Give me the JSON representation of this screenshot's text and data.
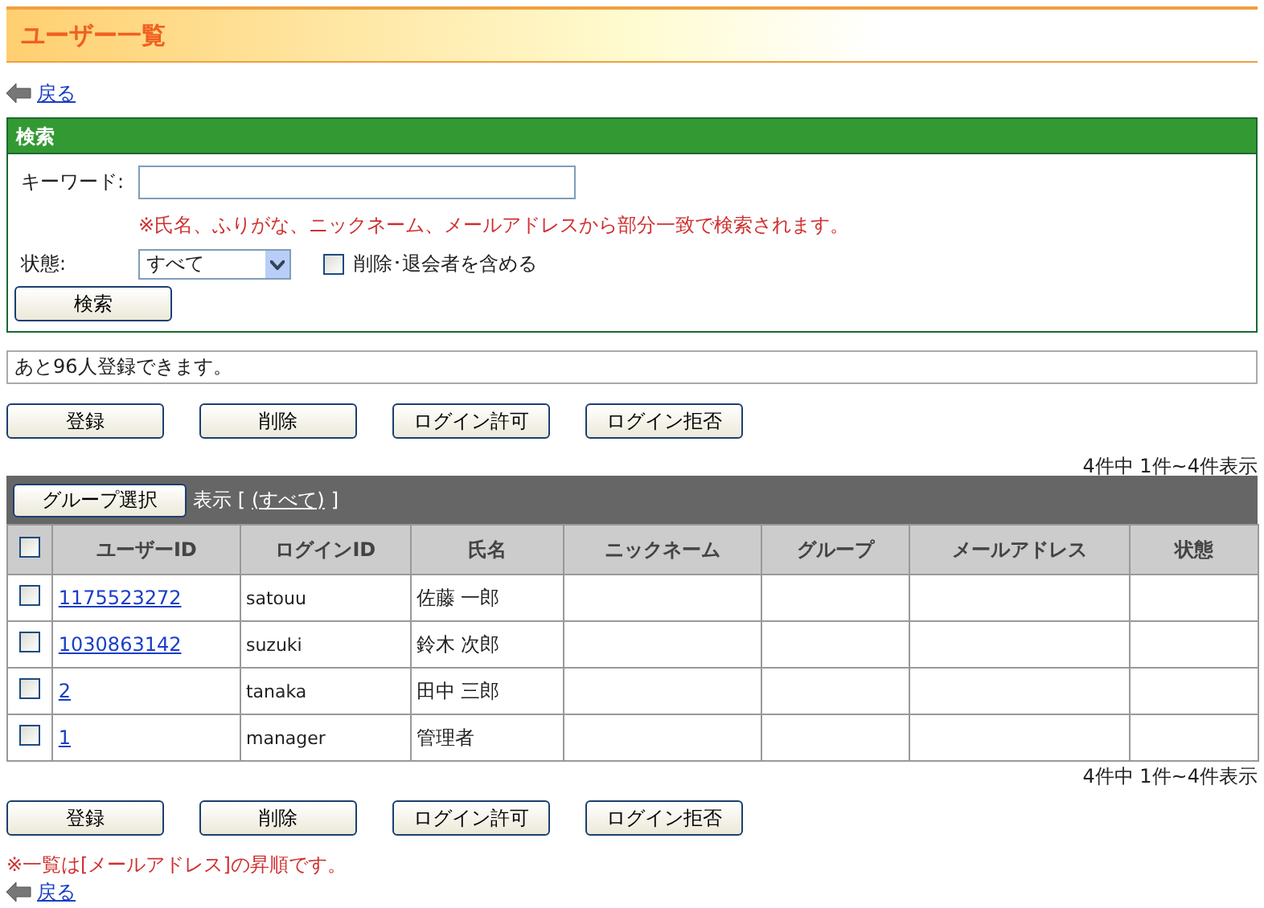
{
  "title": "ユーザー一覧",
  "back_link_top": "戻る",
  "search": {
    "title": "検索",
    "keyword_label": "キーワード:",
    "hint": "※氏名、ふりがな、ニックネーム、メールアドレスから部分一致で検索されます。",
    "status_label": "状態:",
    "status_value": "すべて",
    "include_deleted": {
      "label": "削除･退会者を含める",
      "checked": false
    },
    "button": "検索"
  },
  "info": "あと96人登録できます。",
  "buttons_top": [
    "登録",
    "削除",
    "ログイン許可",
    "ログイン拒否"
  ],
  "count_top": "4件中 1件~4件表示",
  "toolbar": {
    "group_button": "グループ選択",
    "display_prefix": "表示 [",
    "display_link": "(すべて)",
    "display_suffix": "]"
  },
  "table": {
    "select_all_checked": false,
    "columns": [
      "ユーザーID",
      "ログインID",
      "氏名",
      "ニックネーム",
      "グループ",
      "メールアドレス",
      "状態"
    ],
    "rows": [
      {
        "checked": false,
        "user_id": "1175523272",
        "login_id": "satouu",
        "name": "佐藤 一郎"
      },
      {
        "checked": false,
        "user_id": "1030863142",
        "login_id": "suzuki",
        "name": "鈴木 次郎"
      },
      {
        "checked": false,
        "user_id": "2",
        "login_id": "tanaka",
        "name": "田中 三郎"
      },
      {
        "checked": false,
        "user_id": "1",
        "login_id": "manager",
        "name": "管理者"
      }
    ]
  },
  "count_bottom": "4件中 1件~4件表示",
  "buttons_bottom": [
    "登録",
    "削除",
    "ログイン許可",
    "ログイン拒否"
  ],
  "sort_note": "※一覧は[メールアドレス]の昇順です。",
  "back_link_bottom": "戻る"
}
